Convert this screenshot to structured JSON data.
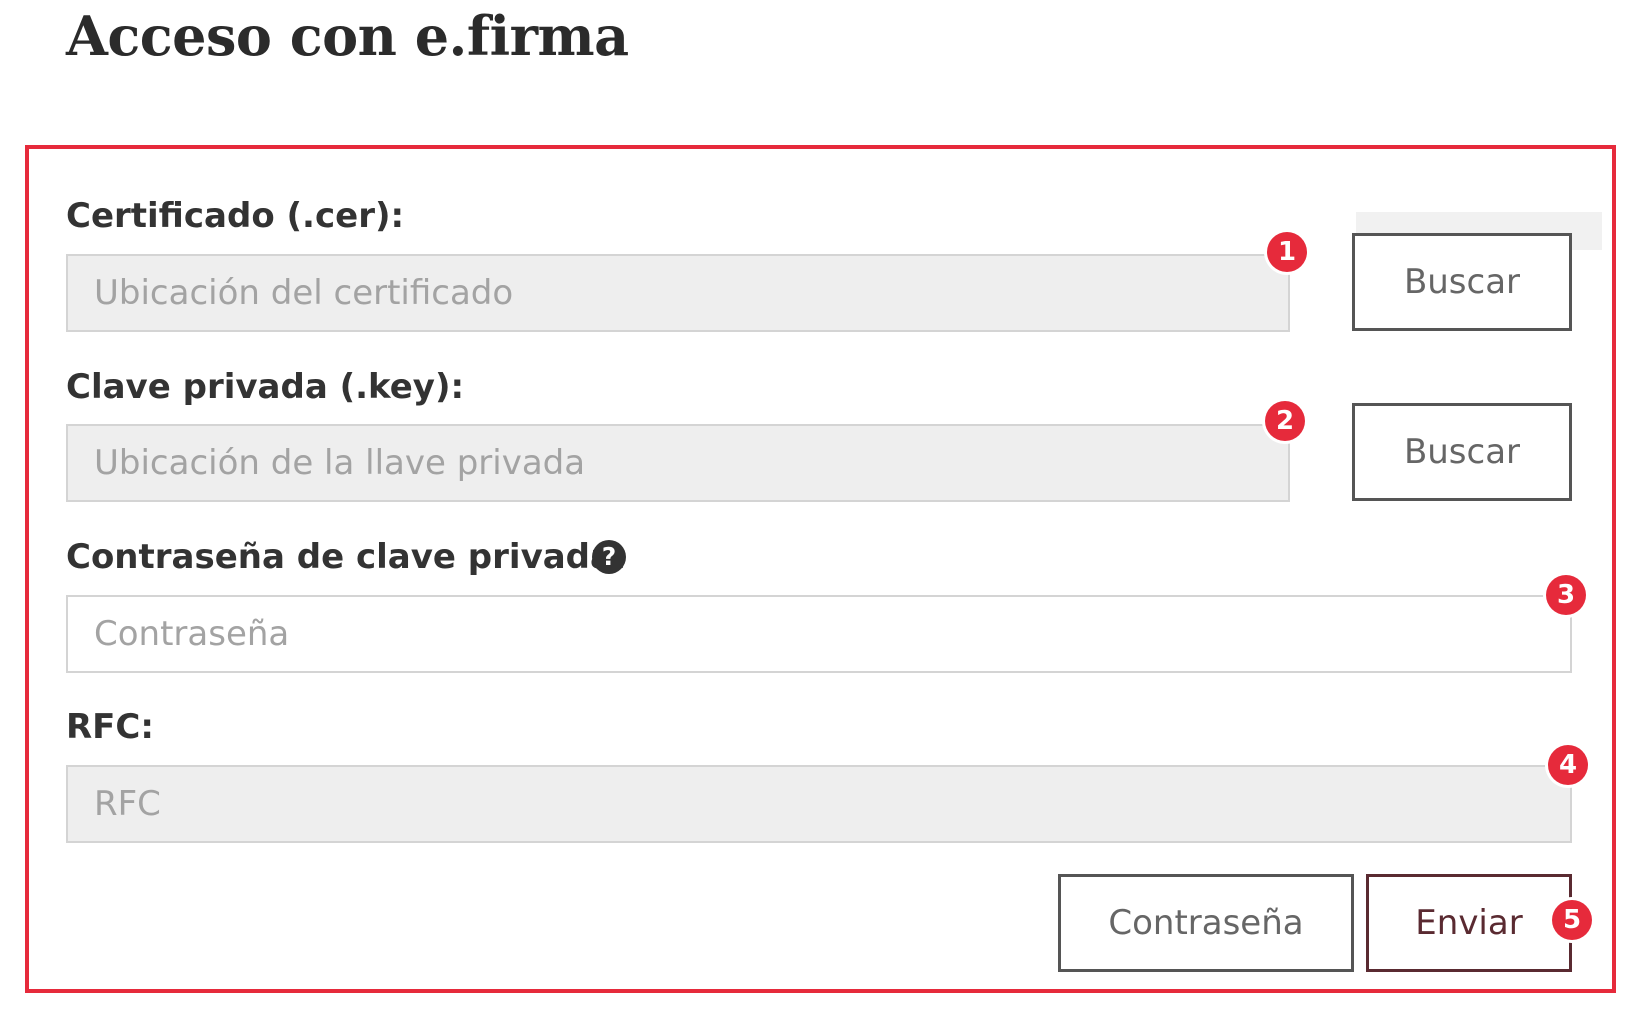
{
  "page": {
    "title": "Acceso con e.firma"
  },
  "form": {
    "certificate": {
      "label": "Certificado (.cer):",
      "placeholder": "Ubicación del certificado",
      "button_label": "Buscar",
      "badge": "1"
    },
    "private_key": {
      "label": "Clave privada (.key):",
      "placeholder": "Ubicación de la llave privada",
      "button_label": "Buscar",
      "badge": "2"
    },
    "password": {
      "label": "Contraseña de clave privada:",
      "placeholder": "Contraseña",
      "help_icon": "question-circle-icon",
      "help_glyph": "?",
      "badge": "3"
    },
    "rfc": {
      "label": "RFC:",
      "placeholder": "RFC",
      "badge": "4"
    },
    "actions": {
      "password_button_label": "Contraseña",
      "submit_button_label": "Enviar",
      "badge": "5"
    }
  },
  "colors": {
    "highlight_red": "#e62a3b",
    "primary_button": "#5a2a31",
    "field_disabled_bg": "#eeeeee"
  }
}
